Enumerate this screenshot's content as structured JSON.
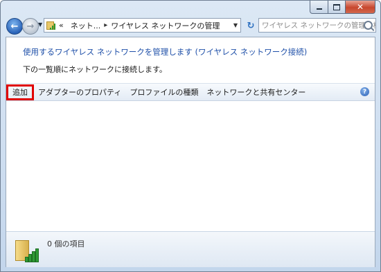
{
  "titlebar": {
    "minimize_icon": "minimize-icon",
    "maximize_icon": "maximize-icon",
    "close_icon": "close-icon",
    "close_color": "#c7462d"
  },
  "nav": {
    "back_icon": "back-arrow-icon",
    "forward_icon": "forward-arrow-icon",
    "breadcrumb": {
      "overflow": "«",
      "items": [
        "ネット...",
        "ワイヤレス ネットワークの管理"
      ]
    },
    "search_placeholder": "ワイヤレス ネットワークの管理の検索"
  },
  "main": {
    "headline": "使用するワイヤレス ネットワークを管理します (ワイヤレス ネットワーク接続)",
    "subline": "下の一覧順にネットワークに接続します。",
    "commands": {
      "add": "追加",
      "adapter_properties": "アダプターのプロパティ",
      "profile_types": "プロファイルの種類",
      "network_center": "ネットワークと共有センター"
    },
    "help_glyph": "?"
  },
  "status": {
    "item_count": "0 個の項目"
  },
  "colors": {
    "link": "#1e4fa8",
    "highlight": "#e00000"
  }
}
